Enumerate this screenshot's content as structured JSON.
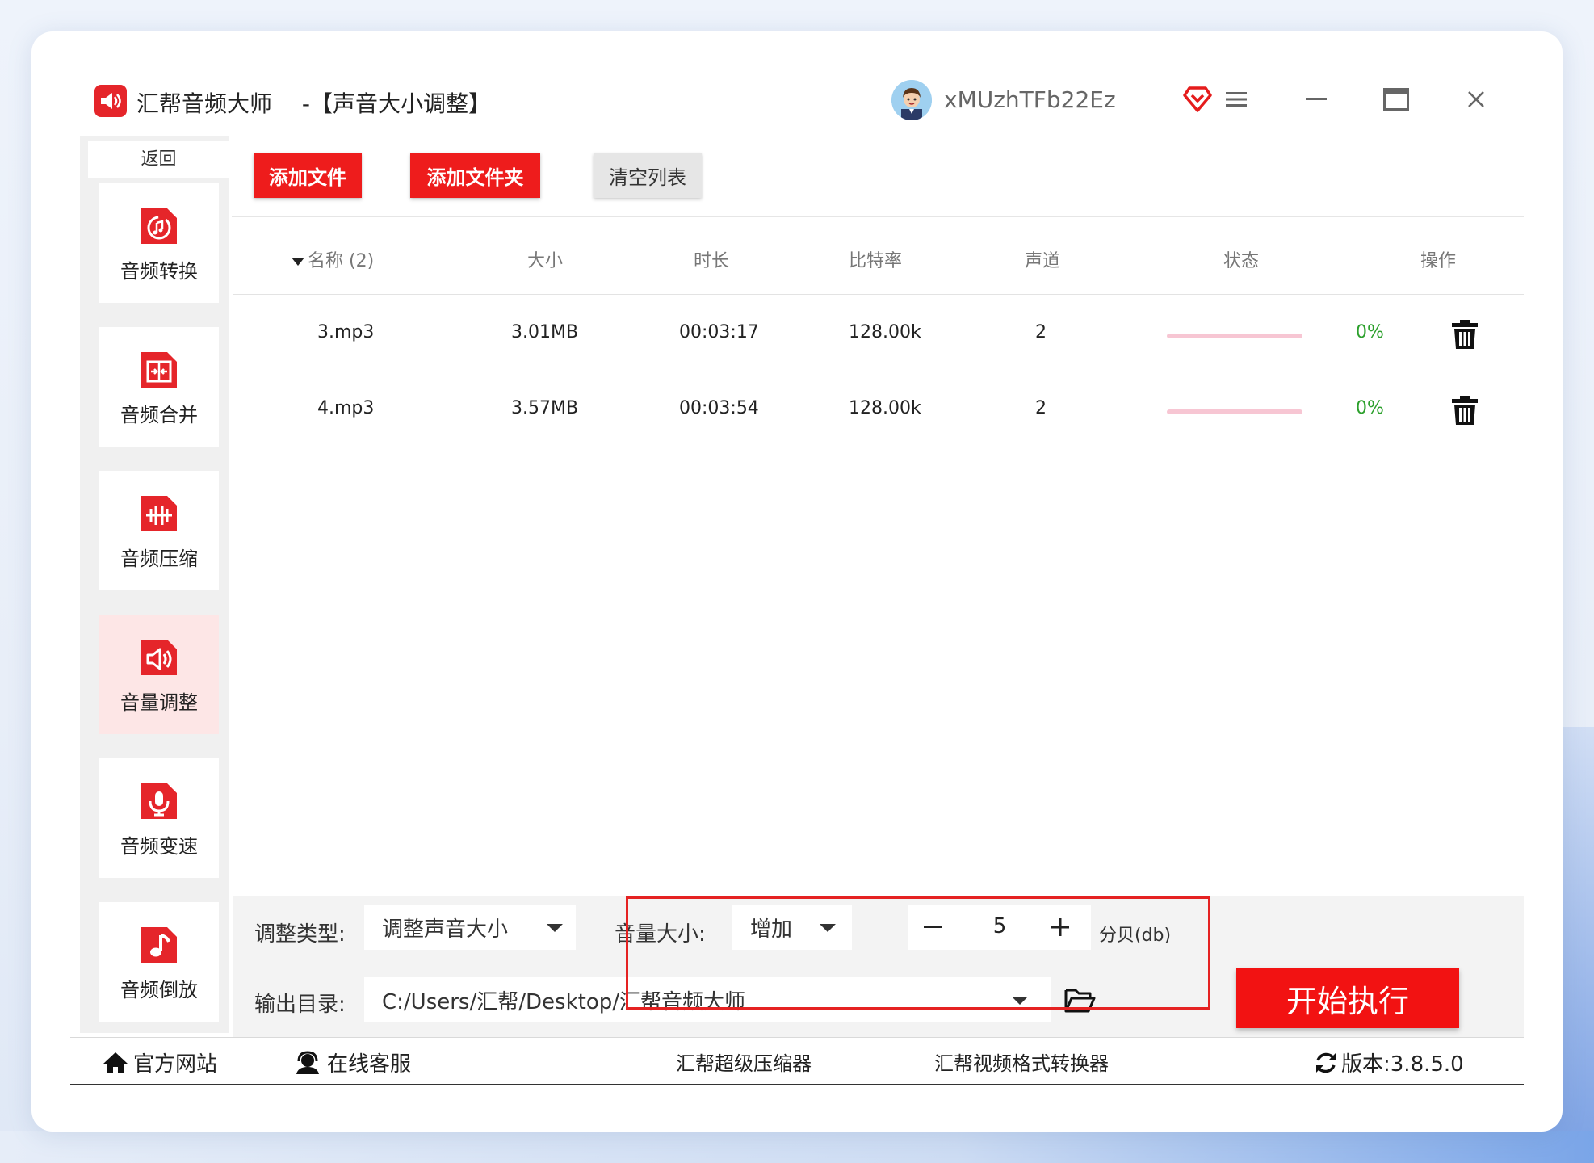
{
  "window": {
    "app_name": "汇帮音频大师",
    "page_title": "-【声音大小调整】",
    "username": "xMUzhTFb22Ez"
  },
  "sidebar": {
    "back_label": "返回",
    "items": [
      {
        "label": "音频转换",
        "icon": "audio-convert-icon"
      },
      {
        "label": "音频合并",
        "icon": "audio-merge-icon"
      },
      {
        "label": "音频压缩",
        "icon": "audio-compress-icon"
      },
      {
        "label": "音量调整",
        "icon": "volume-adjust-icon",
        "active": true
      },
      {
        "label": "音频变速",
        "icon": "audio-speed-icon"
      },
      {
        "label": "音频倒放",
        "icon": "audio-reverse-icon"
      }
    ]
  },
  "toolbar": {
    "add_file": "添加文件",
    "add_folder": "添加文件夹",
    "clear_list": "清空列表"
  },
  "table": {
    "headers": {
      "name": "名称 (2)",
      "size": "大小",
      "duration": "时长",
      "bitrate": "比特率",
      "channels": "声道",
      "status": "状态",
      "action": "操作"
    },
    "rows": [
      {
        "name": "3.mp3",
        "size": "3.01MB",
        "duration": "00:03:17",
        "bitrate": "128.00k",
        "channels": "2",
        "progress": "0%"
      },
      {
        "name": "4.mp3",
        "size": "3.57MB",
        "duration": "00:03:54",
        "bitrate": "128.00k",
        "channels": "2",
        "progress": "0%"
      }
    ]
  },
  "settings": {
    "adjust_type_label": "调整类型:",
    "adjust_type_value": "调整声音大小",
    "volume_label": "音量大小:",
    "volume_mode": "增加",
    "volume_value": "5",
    "volume_unit": "分贝(db)",
    "output_label": "输出目录:",
    "output_path": "C:/Users/汇帮/Desktop/汇帮音频大师",
    "start_button": "开始执行"
  },
  "footer": {
    "website": "官方网站",
    "support": "在线客服",
    "link1": "汇帮超级压缩器",
    "link2": "汇帮视频格式转换器",
    "version": "版本:3.8.5.0"
  },
  "colors": {
    "accent_red": "#ee1c1c",
    "progress_pink": "#f7c6d3",
    "percent_green": "#2ca02c",
    "active_sidebar_bg": "#fde6e6"
  }
}
